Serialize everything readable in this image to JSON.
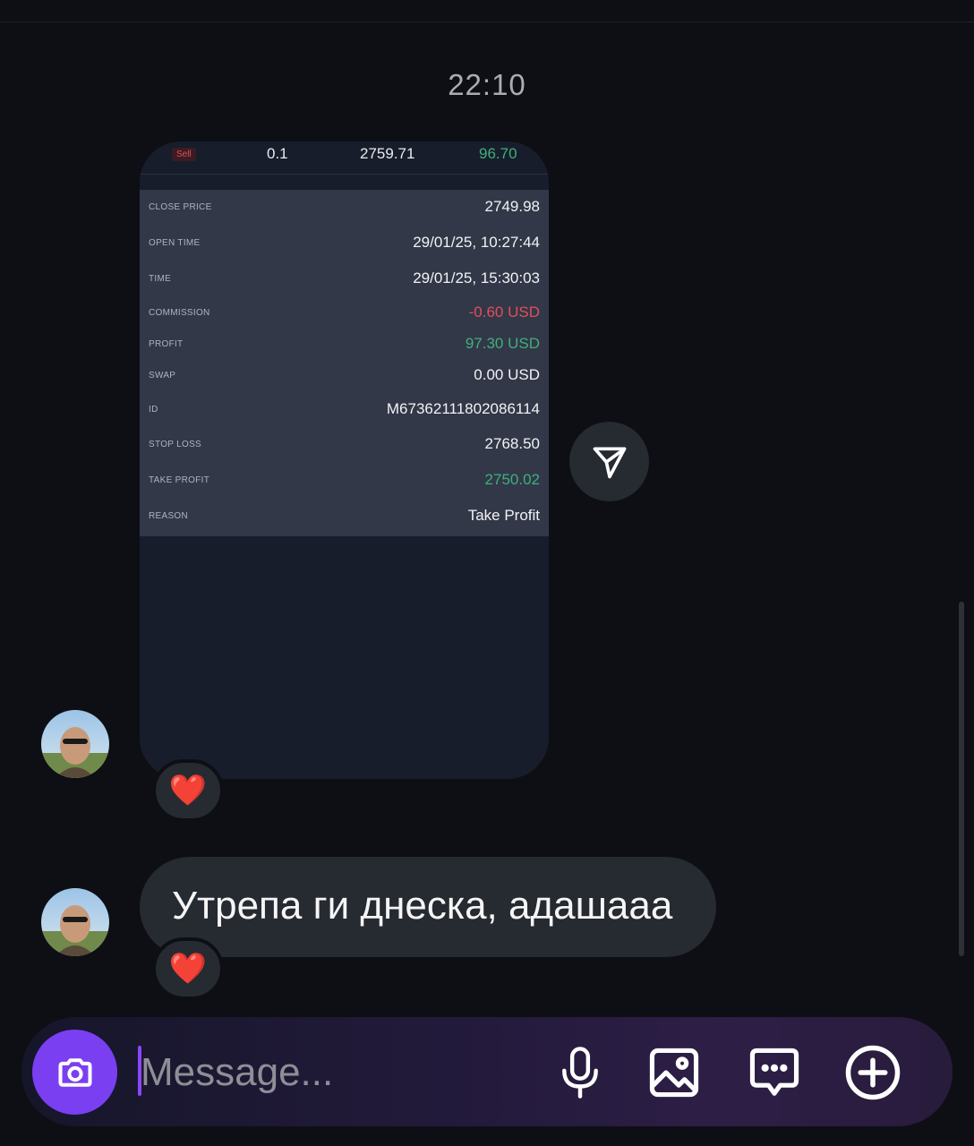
{
  "conversation": {
    "timestamp": "22:10"
  },
  "trade_card": {
    "header": {
      "side": "Sell",
      "lots": "0.1",
      "open_price": "2759.71",
      "pl": "96.70"
    },
    "rows": [
      {
        "label": "CLOSE PRICE",
        "value": "2749.98",
        "tone": "default"
      },
      {
        "label": "OPEN TIME",
        "value": "29/01/25, 10:27:44",
        "tone": "default"
      },
      {
        "label": "TIME",
        "value": "29/01/25, 15:30:03",
        "tone": "default"
      },
      {
        "label": "COMMISSION",
        "value": "-0.60 USD",
        "tone": "red"
      },
      {
        "label": "PROFIT",
        "value": "97.30 USD",
        "tone": "green"
      },
      {
        "label": "SWAP",
        "value": "0.00 USD",
        "tone": "default"
      },
      {
        "label": "ID",
        "value": "M6736211180208611​4",
        "tone": "default"
      },
      {
        "label": "STOP LOSS",
        "value": "2768.50",
        "tone": "default"
      },
      {
        "label": "TAKE PROFIT",
        "value": "2750.02",
        "tone": "green"
      },
      {
        "label": "REASON",
        "value": "Take Profit",
        "tone": "default"
      }
    ]
  },
  "messages": [
    {
      "text": "Утрепа ги днеска, адашааа",
      "reaction": "❤️"
    }
  ],
  "photo_reaction": "❤️",
  "composer": {
    "placeholder": "Message..."
  },
  "colors": {
    "background": "#0d0f14",
    "bubble": "#262a31",
    "accent": "#7b3ff2",
    "profit_green": "#3fb07a",
    "loss_red": "#e0505a"
  },
  "icons": {
    "share": "paper-plane-icon",
    "camera": "camera-icon",
    "mic": "microphone-icon",
    "gallery": "image-icon",
    "sticker": "chat-bubble-icon",
    "more": "plus-circle-icon",
    "reaction": "heart-emoji"
  }
}
